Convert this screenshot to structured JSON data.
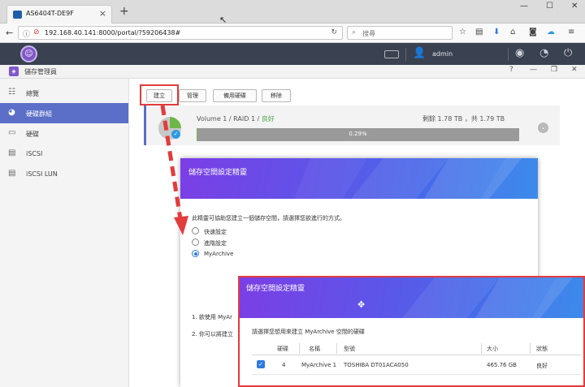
{
  "browser": {
    "tab_title": "AS6404T-DE9F",
    "url": "192.168.40.141:8000/portal/?59206438#",
    "search_placeholder": "搜尋"
  },
  "adm": {
    "username": "admin"
  },
  "storage_manager": {
    "title": "儲存管理員",
    "sidebar": [
      {
        "label": "總覽",
        "icon": "list-icon",
        "active": false
      },
      {
        "label": "硬碟群組",
        "icon": "pie-chart-icon",
        "active": true
      },
      {
        "label": "硬碟",
        "icon": "hard-drive-icon",
        "active": false
      },
      {
        "label": "iSCSI",
        "icon": "database-icon",
        "active": false
      },
      {
        "label": "iSCSI LUN",
        "icon": "database-icon",
        "active": false
      }
    ],
    "toolbar": {
      "create": "建立",
      "manage": "管理",
      "spare": "備用硬碟",
      "remove": "移除"
    },
    "volume": {
      "name": "Volume 1 / RAID 1 / ",
      "status": "良好",
      "capacity": "剩餘 1.78 TB ，共 1.79 TB",
      "usage_percent_label": "0.29%",
      "usage_fraction": 0.0029
    }
  },
  "wizard1": {
    "title": "儲存空間設定精靈",
    "description": "此精靈可協助您建立一個儲存空間，請選擇您欲進行的方式。",
    "options": [
      {
        "label": "快速設定",
        "checked": false
      },
      {
        "label": "進階設定",
        "checked": false
      },
      {
        "label": "MyArchive",
        "checked": true
      }
    ],
    "note1": "1. 欲使用 MyAr",
    "note2": "2. 你可以將建立"
  },
  "wizard2": {
    "title": "儲存空間設定精靈",
    "description": "請選擇您想用來建立 MyArchive 空間的硬碟",
    "columns": [
      "硬碟",
      "名稱",
      "型號",
      "大小",
      "狀態"
    ],
    "rows": [
      {
        "disk": "4",
        "name": "MyArchive 1",
        "model": "TOSHIBA DT01ACA050",
        "size": "465.76 GB",
        "status": "良好",
        "checked": true
      }
    ]
  }
}
